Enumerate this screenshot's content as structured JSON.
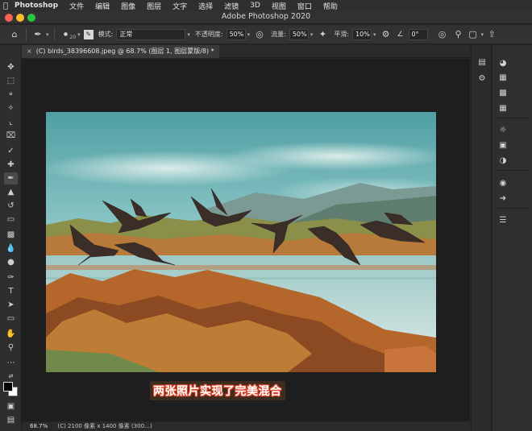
{
  "menubar": {
    "items": [
      "Photoshop",
      "文件",
      "编辑",
      "图像",
      "图层",
      "文字",
      "选择",
      "滤镜",
      "3D",
      "视图",
      "窗口",
      "帮助"
    ]
  },
  "window": {
    "title": "Adobe Photoshop 2020"
  },
  "options_bar": {
    "brush_size": "20",
    "mode_label": "模式:",
    "mode_value": "正常",
    "opacity_label": "不透明度:",
    "opacity_value": "50%",
    "flow_label": "流量:",
    "flow_value": "50%",
    "smoothing_label": "平滑:",
    "smoothing_value": "10%",
    "angle_value": "0°"
  },
  "document": {
    "tab_close": "×",
    "tab_title": "(C) birds_38396608.jpeg @ 68.7% (图层 1, 图层蒙版/8) *"
  },
  "caption": {
    "text": "两张照片实现了完美混合"
  },
  "status_bar": {
    "zoom": "68.7%",
    "info": "(C) 2100 像素 x 1400 像素 (300…)"
  },
  "toolbar": {
    "tools": [
      "move-icon",
      "marquee-icon",
      "lasso-icon",
      "magic-wand-icon",
      "crop-icon",
      "frame-icon",
      "eyedropper-icon",
      "healing-brush-icon",
      "brush-icon",
      "clone-stamp-icon",
      "history-brush-icon",
      "eraser-icon",
      "gradient-icon",
      "blur-icon",
      "dodge-icon",
      "pen-icon",
      "type-icon",
      "path-selection-icon",
      "rectangle-icon",
      "hand-icon",
      "zoom-icon",
      "more-tools-icon"
    ],
    "active_tool": "brush-icon",
    "foreground_color": "#000000",
    "background_color": "#ffffff"
  },
  "right_dock": {
    "mid_icons": [
      "history-panel-icon",
      "adjustments-panel-icon"
    ],
    "right_icons": [
      "3d-panel-icon",
      "swatches-panel-icon",
      "gradients-panel-icon",
      "patterns-panel-icon",
      "properties-panel-icon",
      "info-panel-icon",
      "adjustments-icon",
      "channels-icon",
      "paths-icon",
      "layers-panel-icon"
    ]
  }
}
